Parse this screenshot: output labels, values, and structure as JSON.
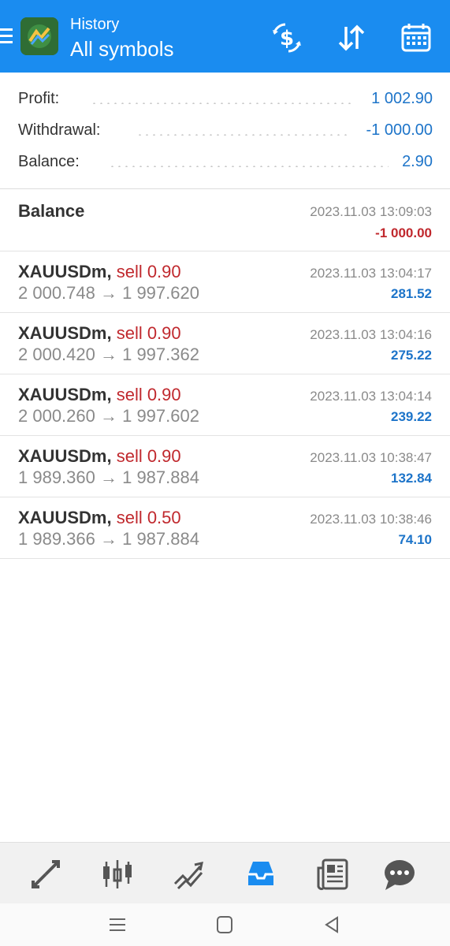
{
  "header": {
    "subtitle": "History",
    "title": "All symbols",
    "background": "#1a8cf0"
  },
  "summary": {
    "profit_label": "Profit:",
    "profit_value": "1 002.90",
    "withdrawal_label": "Withdrawal:",
    "withdrawal_value": "-1 000.00",
    "balance_label": "Balance:",
    "balance_value": "2.90"
  },
  "balance_entry": {
    "label": "Balance",
    "time": "2023.11.03 13:09:03",
    "amount": "-1 000.00"
  },
  "deals": [
    {
      "symbol": "XAUUSDm,",
      "side": "sell 0.90",
      "time": "2023.11.03 13:04:17",
      "prices": "2 000.748 → 1 997.620",
      "profit": "281.52"
    },
    {
      "symbol": "XAUUSDm,",
      "side": "sell 0.90",
      "time": "2023.11.03 13:04:16",
      "prices": "2 000.420 → 1 997.362",
      "profit": "275.22"
    },
    {
      "symbol": "XAUUSDm,",
      "side": "sell 0.90",
      "time": "2023.11.03 13:04:14",
      "prices": "2 000.260 → 1 997.602",
      "profit": "239.22"
    },
    {
      "symbol": "XAUUSDm,",
      "side": "sell 0.90",
      "time": "2023.11.03 10:38:47",
      "prices": "1 989.360 → 1 987.884",
      "profit": "132.84"
    },
    {
      "symbol": "XAUUSDm,",
      "side": "sell 0.50",
      "time": "2023.11.03 10:38:46",
      "prices": "1 989.366 → 1 987.884",
      "profit": "74.10"
    }
  ],
  "icons": {
    "header_actions": [
      "dollar-refresh-icon",
      "sort-icon",
      "calendar-icon"
    ],
    "tabs": [
      "quotes-icon",
      "chart-icon",
      "trade-icon",
      "history-icon",
      "news-icon",
      "messages-icon"
    ],
    "active_tab": "history-icon",
    "system_nav": [
      "recents-icon",
      "home-icon",
      "back-icon"
    ]
  },
  "colors": {
    "accent": "#1a8cf0",
    "positive": "#1d74c9",
    "negative": "#c0282d",
    "muted": "#8a8a8a"
  }
}
